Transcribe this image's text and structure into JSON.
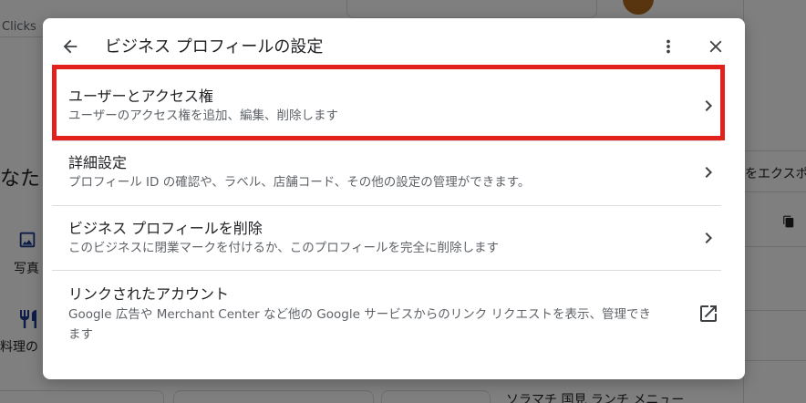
{
  "background": {
    "clicks_label": "Clicks",
    "heading_fragment": "なた",
    "photo_label": "写真",
    "food_label": "料理の",
    "export_fragment": "をエクスポ",
    "search_fragment": "ソラマチ 国見 ランチ メニュー"
  },
  "dialog": {
    "title": "ビジネス プロフィールの設定",
    "items": [
      {
        "title": "ユーザーとアクセス権",
        "description": "ユーザーのアクセス権を追加、編集、削除します"
      },
      {
        "title": "詳細設定",
        "description": "プロフィール ID の確認や、ラベル、店舗コード、その他の設定の管理ができます。"
      },
      {
        "title": "ビジネス プロフィールを削除",
        "description": "このビジネスに閉業マークを付けるか、このプロフィールを完全に削除します"
      },
      {
        "title": "リンクされたアカウント",
        "description": "Google 広告や Merchant Center など他の Google サービスからのリンク リクエストを表示、管理できます"
      }
    ]
  },
  "colors": {
    "highlight": "#e3211c",
    "scrim": "rgba(0,0,0,0.5)",
    "text_primary": "#202124",
    "text_secondary": "#5f6368"
  }
}
